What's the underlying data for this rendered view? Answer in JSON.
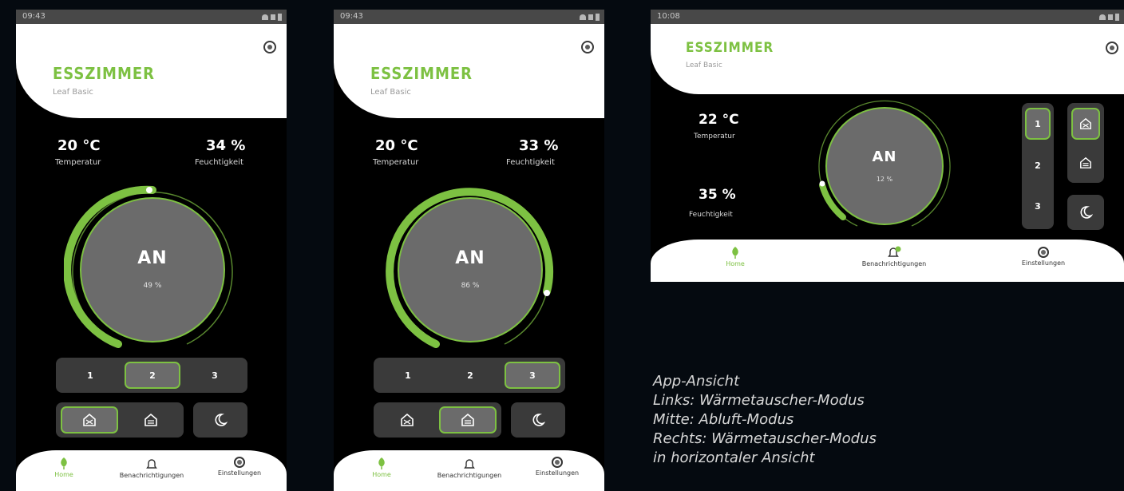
{
  "phones": [
    {
      "status_time": "09:43",
      "room": "ESSZIMMER",
      "model": "Leaf Basic",
      "temperature": "20 °C",
      "temperature_label": "Temperatur",
      "humidity": "34 %",
      "humidity_label": "Feuchtigkeit",
      "state": "AN",
      "level": "49 %",
      "level_value": 49,
      "fan_steps": [
        "1",
        "2",
        "3"
      ],
      "selected_step": "2",
      "modes": [
        "heat-exchanger-icon",
        "exhaust-icon",
        "night-icon"
      ],
      "selected_mode": "heat-exchanger-icon"
    },
    {
      "status_time": "09:43",
      "room": "ESSZIMMER",
      "model": "Leaf Basic",
      "temperature": "20 °C",
      "temperature_label": "Temperatur",
      "humidity": "33 %",
      "humidity_label": "Feuchtigkeit",
      "state": "AN",
      "level": "86 %",
      "level_value": 86,
      "fan_steps": [
        "1",
        "2",
        "3"
      ],
      "selected_step": "3",
      "modes": [
        "heat-exchanger-icon",
        "exhaust-icon",
        "night-icon"
      ],
      "selected_mode": "exhaust-icon"
    },
    {
      "status_time": "10:08",
      "room": "ESSZIMMER",
      "model": "Leaf Basic",
      "temperature": "22 °C",
      "temperature_label": "Temperatur",
      "humidity": "35 %",
      "humidity_label": "Feuchtigkeit",
      "state": "AN",
      "level": "12 %",
      "level_value": 12,
      "fan_steps": [
        "1",
        "2",
        "3"
      ],
      "selected_step": "1",
      "modes": [
        "heat-exchanger-icon",
        "exhaust-icon",
        "night-icon"
      ],
      "selected_mode": "heat-exchanger-icon"
    }
  ],
  "nav": {
    "home": "Home",
    "notifications": "Benachrichtigungen",
    "settings": "Einstellungen"
  },
  "colors": {
    "accent": "#7dc142",
    "background": "#050a10",
    "dial": "#6b6b6b",
    "tile": "#3a3a3a"
  },
  "caption": [
    "App-Ansicht",
    "Links: Wärmetauscher-Modus",
    "Mitte: Abluft-Modus",
    "Rechts: Wärmetauscher-Modus",
    "in horizontaler Ansicht"
  ]
}
